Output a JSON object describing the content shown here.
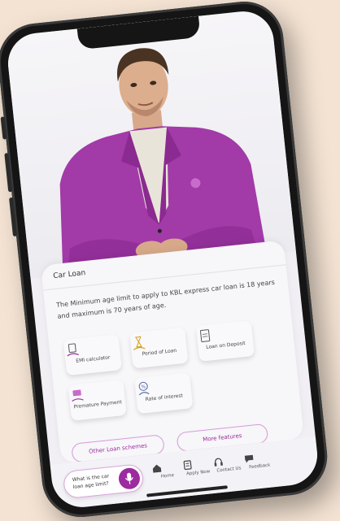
{
  "colors": {
    "accent": "#9b2b9e",
    "background": "#f4e3d3",
    "screen": "#f1eff4"
  },
  "card": {
    "title": "Car Loan",
    "description": "The Minimum age limit to apply to KBL express car loan is 18 years and maximum is 70 years of age."
  },
  "tiles": [
    {
      "label": "EMI calculator",
      "icon": "calculator-hand-icon"
    },
    {
      "label": "Period of Loan",
      "icon": "hourglass-hand-icon"
    },
    {
      "label": "Loan on Deposit",
      "icon": "document-icon"
    },
    {
      "label": "Premature Payment",
      "icon": "cash-hand-icon"
    },
    {
      "label": "Rate of interest",
      "icon": "percent-person-icon"
    }
  ],
  "actions": {
    "other_loans": "Other Loan schemes",
    "more_features": "More features"
  },
  "query": {
    "text": "What is the car loan age limit?",
    "icon": "microphone-icon"
  },
  "nav": [
    {
      "label": "Home",
      "icon": "home-icon"
    },
    {
      "label": "Apply Now",
      "icon": "apply-icon"
    },
    {
      "label": "Contact Us",
      "icon": "headset-icon"
    },
    {
      "label": "Feedback",
      "icon": "feedback-icon"
    }
  ]
}
